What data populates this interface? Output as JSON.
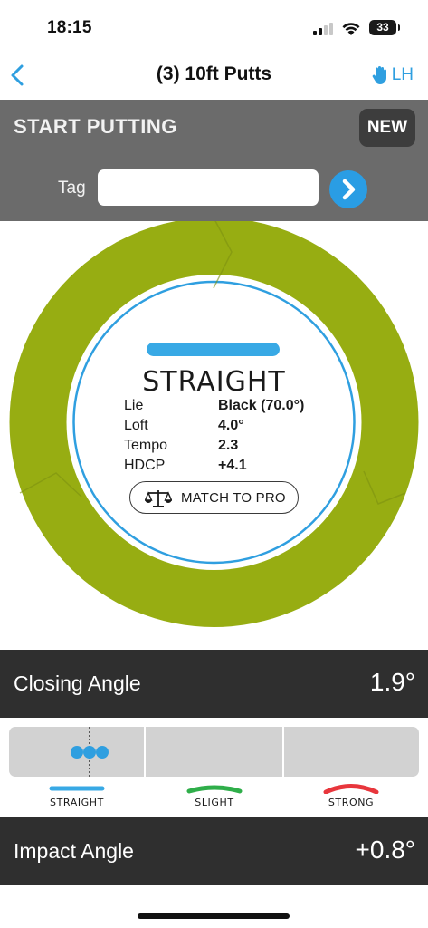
{
  "status_bar": {
    "time": "18:15",
    "battery": "33"
  },
  "nav": {
    "title": "(3) 10ft Putts",
    "hand_label": "LH"
  },
  "start_panel": {
    "title": "START PUTTING",
    "new_label": "NEW",
    "tag_label": "Tag",
    "tag_value": ""
  },
  "result": {
    "label": "STRAIGHT",
    "stats": [
      {
        "key": "Lie",
        "value": "Black (70.0°)"
      },
      {
        "key": "Loft",
        "value": "4.0°"
      },
      {
        "key": "Tempo",
        "value": "2.3"
      },
      {
        "key": "HDCP",
        "value": "+4.1"
      }
    ],
    "match_label": "MATCH TO PRO"
  },
  "closing_angle": {
    "label": "Closing Angle",
    "value": "1.9°"
  },
  "gauge_legend": [
    {
      "label": "STRAIGHT",
      "color": "#38a9e5"
    },
    {
      "label": "SLIGHT",
      "color": "#2fae4a"
    },
    {
      "label": "STRONG",
      "color": "#e8363c"
    }
  ],
  "impact_angle": {
    "label": "Impact Angle",
    "value": "+0.8°"
  },
  "colors": {
    "ring": "#97ad12",
    "accent": "#2f9fe0",
    "panel": "#6b6b6b",
    "dark_bar": "#2f2f2f"
  }
}
